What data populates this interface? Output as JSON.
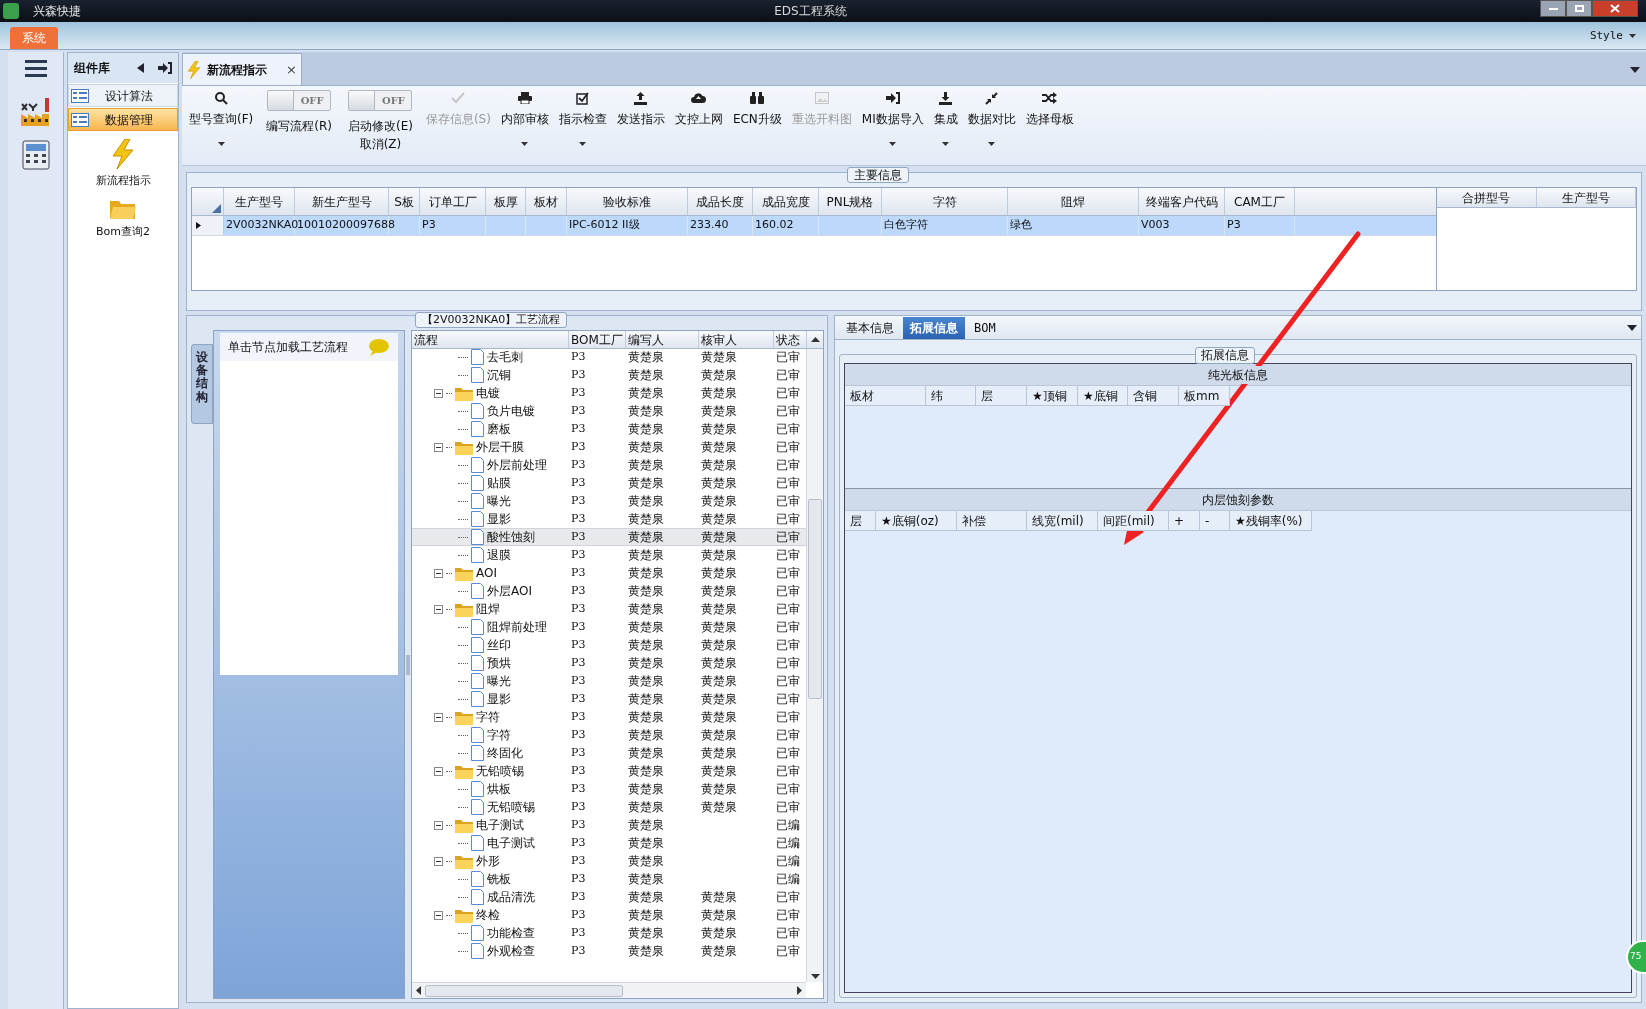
{
  "window": {
    "app_name": "兴森快捷",
    "title": "EDS工程系统"
  },
  "menu": {
    "tabs": [
      {
        "label": "系统",
        "selected": true
      }
    ],
    "style_label": "Style"
  },
  "component_panel": {
    "title": "组件库",
    "items": [
      {
        "label": "设计算法",
        "selected": false
      },
      {
        "label": "数据管理",
        "selected": true
      }
    ],
    "tools": [
      {
        "label": "新流程指示",
        "kind": "bolt"
      },
      {
        "label": "Bom查询2",
        "kind": "folder"
      }
    ]
  },
  "doc_tabs": [
    {
      "label": "新流程指示",
      "selected": true,
      "close": "×"
    }
  ],
  "toolbar": [
    {
      "kind": "button",
      "label": "型号查询(F)",
      "dropdown": true,
      "disabled": false
    },
    {
      "kind": "toggle",
      "label": "编写流程(R)",
      "on": false,
      "state_text": "OFF"
    },
    {
      "kind": "toggle",
      "label": "启动修改(E)",
      "sublabel": "取消(Z)",
      "on": false,
      "state_text": "OFF"
    },
    {
      "kind": "button",
      "label": "保存信息(S)",
      "dropdown": false,
      "disabled": true
    },
    {
      "kind": "button",
      "label": "内部审核",
      "dropdown": true,
      "disabled": false
    },
    {
      "kind": "button",
      "label": "指示检查",
      "dropdown": true,
      "disabled": false
    },
    {
      "kind": "button",
      "label": "发送指示",
      "dropdown": false,
      "disabled": false
    },
    {
      "kind": "button",
      "label": "文控上网",
      "dropdown": false,
      "disabled": false
    },
    {
      "kind": "button",
      "label": "ECN升级",
      "dropdown": false,
      "disabled": false
    },
    {
      "kind": "button",
      "label": "重选开料图",
      "dropdown": false,
      "disabled": true
    },
    {
      "kind": "button",
      "label": "MI数据导入",
      "dropdown": true,
      "disabled": false
    },
    {
      "kind": "button",
      "label": "集成",
      "dropdown": true,
      "disabled": false
    },
    {
      "kind": "button",
      "label": "数据对比",
      "dropdown": true,
      "disabled": false
    },
    {
      "kind": "button",
      "label": "选择母板",
      "dropdown": false,
      "disabled": false
    }
  ],
  "main_info": {
    "title": "主要信息",
    "columns": [
      "生产型号",
      "新生产型号",
      "S板",
      "订单工厂",
      "板厚",
      "板材",
      "验收标准",
      "成品长度",
      "成品宽度",
      "PNL规格",
      "字符",
      "阻焊",
      "终端客户代码",
      "CAM工厂"
    ],
    "rows": [
      {
        "selected": true,
        "cells": [
          "2V0032NKA0",
          "10010200097688",
          null,
          "P3",
          null,
          null,
          "IPC-6012 II级",
          "233.40",
          "160.02",
          null,
          "白色字符",
          "绿色",
          "V003",
          "P3"
        ]
      }
    ],
    "side_columns": [
      "合拼型号",
      "生产型号"
    ]
  },
  "flow_panel": {
    "title": "【2V0032NKA0】工艺流程",
    "side_tab": "设备结构",
    "hint": "单击节点加载工艺流程",
    "columns": [
      "流程",
      "BOM工厂",
      "编写人",
      "核审人",
      "状态"
    ],
    "nodes": [
      {
        "kind": "step",
        "name": "去毛刺",
        "factory": "P3",
        "author": "黄楚泉",
        "reviewer": "黄楚泉",
        "status": "已审",
        "selected": false
      },
      {
        "kind": "step",
        "name": "沉铜",
        "factory": "P3",
        "author": "黄楚泉",
        "reviewer": "黄楚泉",
        "status": "已审",
        "selected": false
      },
      {
        "kind": "group",
        "name": "电镀",
        "factory": "P3",
        "author": "黄楚泉",
        "reviewer": "黄楚泉",
        "status": "已审",
        "selected": false,
        "expanded": true,
        "children": [
          {
            "kind": "step",
            "name": "负片电镀",
            "factory": "P3",
            "author": "黄楚泉",
            "reviewer": "黄楚泉",
            "status": "已审",
            "selected": false
          },
          {
            "kind": "step",
            "name": "磨板",
            "factory": "P3",
            "author": "黄楚泉",
            "reviewer": "黄楚泉",
            "status": "已审",
            "selected": false
          }
        ]
      },
      {
        "kind": "group",
        "name": "外层干膜",
        "factory": "P3",
        "author": "黄楚泉",
        "reviewer": "黄楚泉",
        "status": "已审",
        "selected": false,
        "expanded": true,
        "children": [
          {
            "kind": "step",
            "name": "外层前处理",
            "factory": "P3",
            "author": "黄楚泉",
            "reviewer": "黄楚泉",
            "status": "已审",
            "selected": false
          },
          {
            "kind": "step",
            "name": "贴膜",
            "factory": "P3",
            "author": "黄楚泉",
            "reviewer": "黄楚泉",
            "status": "已审",
            "selected": false
          },
          {
            "kind": "step",
            "name": "曝光",
            "factory": "P3",
            "author": "黄楚泉",
            "reviewer": "黄楚泉",
            "status": "已审",
            "selected": false
          },
          {
            "kind": "step",
            "name": "显影",
            "factory": "P3",
            "author": "黄楚泉",
            "reviewer": "黄楚泉",
            "status": "已审",
            "selected": false
          },
          {
            "kind": "step",
            "name": "酸性蚀刻",
            "factory": "P3",
            "author": "黄楚泉",
            "reviewer": "黄楚泉",
            "status": "已审",
            "selected": true
          },
          {
            "kind": "step",
            "name": "退膜",
            "factory": "P3",
            "author": "黄楚泉",
            "reviewer": "黄楚泉",
            "status": "已审",
            "selected": false
          }
        ]
      },
      {
        "kind": "group",
        "name": "AOI",
        "factory": "P3",
        "author": "黄楚泉",
        "reviewer": "黄楚泉",
        "status": "已审",
        "selected": false,
        "expanded": true,
        "children": [
          {
            "kind": "step",
            "name": "外层AOI",
            "factory": "P3",
            "author": "黄楚泉",
            "reviewer": "黄楚泉",
            "status": "已审",
            "selected": false
          }
        ]
      },
      {
        "kind": "group",
        "name": "阻焊",
        "factory": "P3",
        "author": "黄楚泉",
        "reviewer": "黄楚泉",
        "status": "已审",
        "selected": false,
        "expanded": true,
        "children": [
          {
            "kind": "step",
            "name": "阻焊前处理",
            "factory": "P3",
            "author": "黄楚泉",
            "reviewer": "黄楚泉",
            "status": "已审",
            "selected": false
          },
          {
            "kind": "step",
            "name": "丝印",
            "factory": "P3",
            "author": "黄楚泉",
            "reviewer": "黄楚泉",
            "status": "已审",
            "selected": false
          },
          {
            "kind": "step",
            "name": "预烘",
            "factory": "P3",
            "author": "黄楚泉",
            "reviewer": "黄楚泉",
            "status": "已审",
            "selected": false
          },
          {
            "kind": "step",
            "name": "曝光",
            "factory": "P3",
            "author": "黄楚泉",
            "reviewer": "黄楚泉",
            "status": "已审",
            "selected": false
          },
          {
            "kind": "step",
            "name": "显影",
            "factory": "P3",
            "author": "黄楚泉",
            "reviewer": "黄楚泉",
            "status": "已审",
            "selected": false
          }
        ]
      },
      {
        "kind": "group",
        "name": "字符",
        "factory": "P3",
        "author": "黄楚泉",
        "reviewer": "黄楚泉",
        "status": "已审",
        "selected": false,
        "expanded": true,
        "children": [
          {
            "kind": "step",
            "name": "字符",
            "factory": "P3",
            "author": "黄楚泉",
            "reviewer": "黄楚泉",
            "status": "已审",
            "selected": false
          },
          {
            "kind": "step",
            "name": "终固化",
            "factory": "P3",
            "author": "黄楚泉",
            "reviewer": "黄楚泉",
            "status": "已审",
            "selected": false
          }
        ]
      },
      {
        "kind": "group",
        "name": "无铅喷锡",
        "factory": "P3",
        "author": "黄楚泉",
        "reviewer": "黄楚泉",
        "status": "已审",
        "selected": false,
        "expanded": true,
        "children": [
          {
            "kind": "step",
            "name": "烘板",
            "factory": "P3",
            "author": "黄楚泉",
            "reviewer": "黄楚泉",
            "status": "已审",
            "selected": false
          },
          {
            "kind": "step",
            "name": "无铅喷锡",
            "factory": "P3",
            "author": "黄楚泉",
            "reviewer": "黄楚泉",
            "status": "已审",
            "selected": false
          }
        ]
      },
      {
        "kind": "group",
        "name": "电子测试",
        "factory": "P3",
        "author": "黄楚泉",
        "status": "已编",
        "selected": false,
        "expanded": true,
        "children": [
          {
            "kind": "step",
            "name": "电子测试",
            "factory": "P3",
            "author": "黄楚泉",
            "status": "已编",
            "selected": false
          }
        ]
      },
      {
        "kind": "group",
        "name": "外形",
        "factory": "P3",
        "author": "黄楚泉",
        "status": "已编",
        "selected": false,
        "expanded": true,
        "children": [
          {
            "kind": "step",
            "name": "铣板",
            "factory": "P3",
            "author": "黄楚泉",
            "status": "已编",
            "selected": false
          },
          {
            "kind": "step",
            "name": "成品清洗",
            "factory": "P3",
            "author": "黄楚泉",
            "reviewer": "黄楚泉",
            "status": "已审",
            "selected": false
          }
        ]
      },
      {
        "kind": "group",
        "name": "终检",
        "factory": "P3",
        "author": "黄楚泉",
        "reviewer": "黄楚泉",
        "status": "已审",
        "selected": false,
        "expanded": true,
        "children": [
          {
            "kind": "step",
            "name": "功能检查",
            "factory": "P3",
            "author": "黄楚泉",
            "reviewer": "黄楚泉",
            "status": "已审",
            "selected": false
          },
          {
            "kind": "step",
            "name": "外观检查",
            "factory": "P3",
            "author": "黄楚泉",
            "reviewer": "黄楚泉",
            "status": "已审",
            "selected": false
          }
        ]
      }
    ]
  },
  "detail": {
    "tabs": [
      {
        "label": "基本信息",
        "selected": false
      },
      {
        "label": "拓展信息",
        "selected": true
      },
      {
        "label": "BOM",
        "selected": false
      }
    ],
    "group_title": "拓展信息",
    "sections": [
      {
        "title": "纯光板信息",
        "columns": [
          "板材",
          "纬",
          "层",
          "★顶铜",
          "★底铜",
          "含铜",
          "板mm"
        ]
      },
      {
        "title": "内层蚀刻参数",
        "columns": [
          "层",
          "★底铜(oz)",
          "补偿",
          "线宽(mil)",
          "间距(mil)",
          "+",
          "-",
          "★残铜率(%)"
        ]
      }
    ]
  },
  "badge": "75"
}
